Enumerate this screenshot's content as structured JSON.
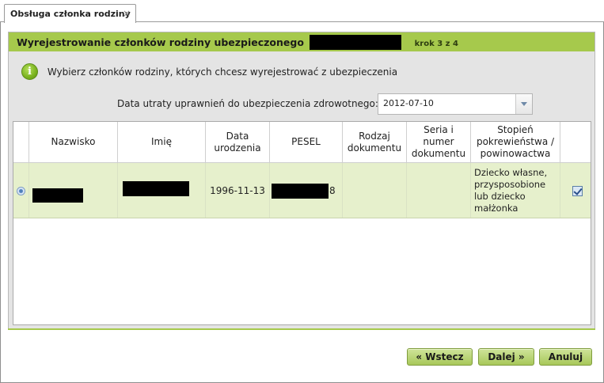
{
  "tab": {
    "title": "Obsługa członka rodziny",
    "close": "×"
  },
  "panel": {
    "title": "Wyrejestrowanie członków rodziny ubezpieczonego",
    "step": "krok 3 z 4"
  },
  "info": {
    "icon": "info-icon",
    "text": "Wybierz członków rodziny, których chcesz wyrejestrować z ubezpieczenia"
  },
  "date_field": {
    "label": "Data utraty uprawnień do ubezpieczenia zdrowotnego:",
    "value": "2012-07-10"
  },
  "table": {
    "headers": {
      "nazwisko": "Nazwisko",
      "imie": "Imię",
      "data_urodzenia": "Data\nurodzenia",
      "pesel": "PESEL",
      "rodzaj": "Rodzaj\ndokumentu",
      "seria": "Seria i\nnumer\ndokumentu",
      "stopien": "Stopień\npokrewieństwa /\npowinowactwa"
    },
    "rows": [
      {
        "data_urodzenia": "1996-11-13",
        "pesel_tail": "8",
        "rodzaj": "",
        "seria": "",
        "stopien": "Dziecko własne,\nprzysposobione\nlub dziecko\nmałżonka",
        "checked": true
      }
    ]
  },
  "buttons": {
    "back": "« Wstecz",
    "next": "Dalej »",
    "cancel": "Anuluj"
  },
  "colors": {
    "accent": "#a6c94c",
    "row_highlight": "#e6f0cc"
  }
}
